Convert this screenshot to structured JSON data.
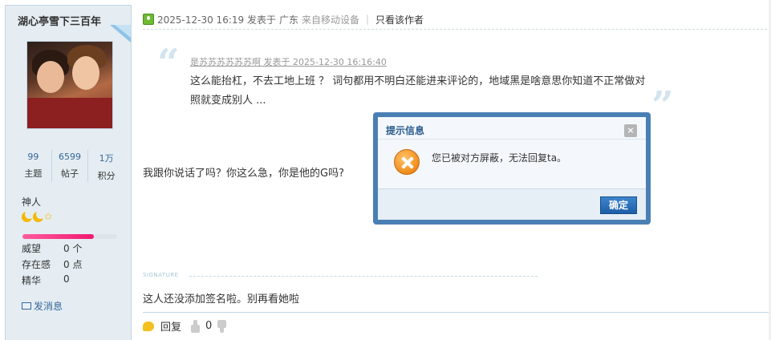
{
  "sidebar": {
    "author_name": "湖心亭雪下三百年",
    "stats": [
      {
        "value": "99",
        "label": "主题"
      },
      {
        "value": "6599",
        "label": "帖子"
      },
      {
        "value": "1万",
        "label": "积分"
      }
    ],
    "usergroup": "神人",
    "level_progress": 0.75,
    "profile": [
      {
        "label": "威望",
        "value": "0 个"
      },
      {
        "label": "存在感",
        "value": "0 点"
      },
      {
        "label": "精华",
        "value": "0"
      }
    ],
    "pm_label": "发消息"
  },
  "post": {
    "date": "2025-12-30 16:19 发表于",
    "location": "广东",
    "device": "来自移动设备",
    "separator": "|",
    "only_author": "只看该作者",
    "quote": {
      "author_line": "是苏苏苏苏苏苏啊 发表于 2025-12-30 16:16:40",
      "text": "这么能抬杠，不去工地上班 ？ 词句都用不明白还能进来评论的，地域黑是啥意思你知道不正常做对照就变成别人 ..."
    },
    "reply_text": "我跟你说话了吗？你这么急，你是他的G吗?",
    "signature_label": "SIGNATURE",
    "signature_text": "这人还没添加签名啦。别再看她啦",
    "footer": {
      "reply_label": "回复",
      "like_count": "0"
    }
  },
  "dialog": {
    "title": "提示信息",
    "close_glyph": "×",
    "message": "您已被对方屏蔽，无法回复ta。",
    "ok_label": "确定"
  },
  "colors": {
    "sidebar_bg": "#e5edf2",
    "border": "#c2d5e3",
    "link": "#369",
    "dialog_frame": "#4a7fb4",
    "button": "#1e5ea8"
  }
}
